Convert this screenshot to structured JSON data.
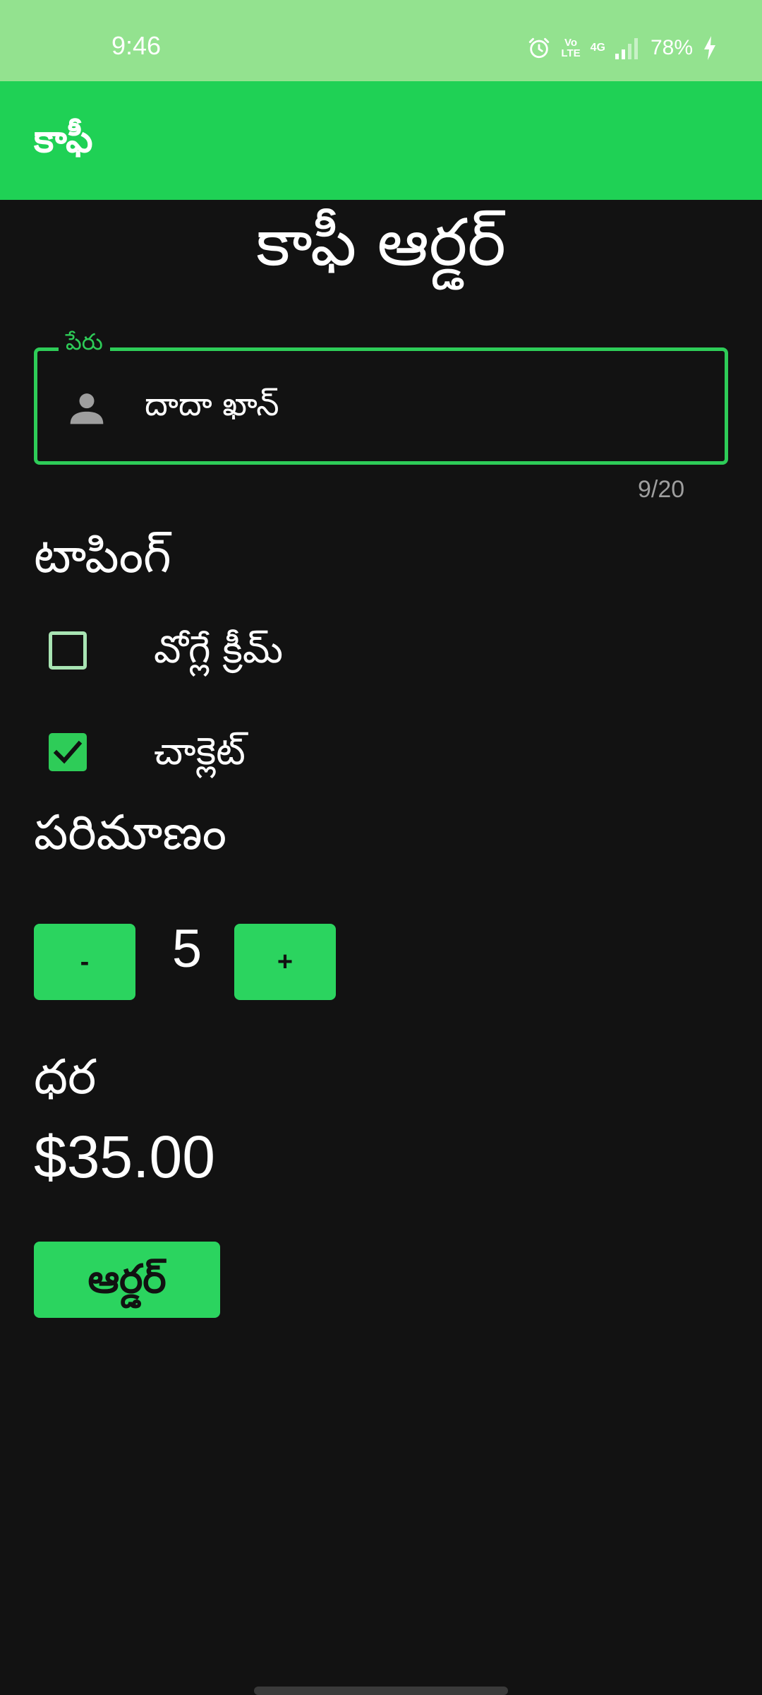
{
  "status_bar": {
    "time": "9:46",
    "battery": "78%",
    "network": "4G",
    "volte_top": "Vo",
    "volte_bottom": "LTE"
  },
  "app_bar": {
    "title": "కాఫీ"
  },
  "page": {
    "title": "కాఫీ ఆర్డర్"
  },
  "name_field": {
    "label": "పేరు",
    "value": "దాదా ఖాన్",
    "counter": "9/20",
    "icon": "person-icon"
  },
  "toppings": {
    "heading": "టాపింగ్",
    "items": [
      {
        "label": "వోగ్లే క్రీమ్",
        "checked": false
      },
      {
        "label": "చాక్లెట్",
        "checked": true
      }
    ]
  },
  "quantity": {
    "heading": "పరిమాణం",
    "decrement_label": "-",
    "increment_label": "+",
    "value": "5"
  },
  "price": {
    "heading": "ధర",
    "value": "$35.00"
  },
  "order_button": {
    "label": "ఆర్డర్"
  },
  "colors": {
    "status_bar": "#93e28f",
    "app_bar": "#1fd155",
    "accent": "#2ecc58",
    "background": "#121212"
  }
}
